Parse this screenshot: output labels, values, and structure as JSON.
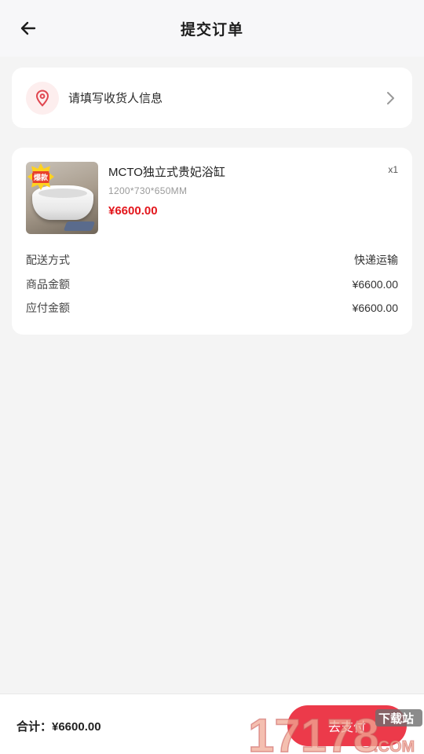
{
  "header": {
    "title": "提交订单"
  },
  "address": {
    "label": "请填写收货人信息"
  },
  "product": {
    "badge": "爆款",
    "name": "MCTO独立式贵妃浴缸",
    "qty": "x1",
    "spec": "1200*730*650MM",
    "price": "¥6600.00"
  },
  "summary": [
    {
      "label": "配送方式",
      "value": "快递运输"
    },
    {
      "label": "商品金额",
      "value": "¥6600.00"
    },
    {
      "label": "应付金额",
      "value": "¥6600.00"
    }
  ],
  "footer": {
    "total": "合计：¥6600.00",
    "pay_label": "去支付"
  },
  "watermark": {
    "numbers": "17178",
    "site": ".COM",
    "tag": "下载站"
  },
  "colors": {
    "accent": "#e3161c",
    "button": "#ec3a4a",
    "location": "#e0464f"
  }
}
